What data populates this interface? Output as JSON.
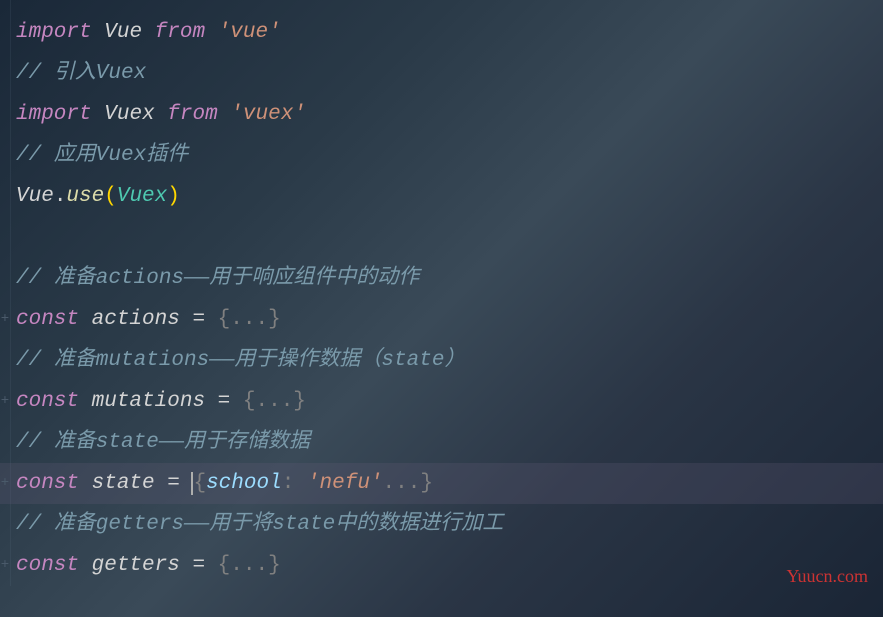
{
  "watermark": "Yuucn.com",
  "lines": {
    "l1": {
      "import": "import",
      "name": "Vue",
      "from": "from",
      "module": "'vue'"
    },
    "l2": {
      "comment": "// 引入Vuex"
    },
    "l3": {
      "import": "import",
      "name": "Vuex",
      "from": "from",
      "module": "'vuex'"
    },
    "l4": {
      "comment": "// 应用Vuex插件"
    },
    "l5": {
      "obj": "Vue",
      "dot": ".",
      "method": "use",
      "lparen": "(",
      "arg": "Vuex",
      "rparen": ")"
    },
    "l7": {
      "comment": "// 准备actions——用于响应组件中的动作"
    },
    "l8": {
      "const": "const",
      "name": "actions",
      "eq": "=",
      "lbrace": "{",
      "dots": "...",
      "rbrace": "}"
    },
    "l9": {
      "comment": "// 准备mutations——用于操作数据（state）"
    },
    "l10": {
      "const": "const",
      "name": "mutations",
      "eq": "=",
      "lbrace": "{",
      "dots": "...",
      "rbrace": "}"
    },
    "l11": {
      "comment": "// 准备state——用于存储数据"
    },
    "l12": {
      "const": "const",
      "name": "state",
      "eq": "=",
      "lbrace": "{",
      "key": "school",
      "colon": ":",
      "val": "'nefu'",
      "dots": "...",
      "rbrace": "}"
    },
    "l13": {
      "comment": "// 准备getters——用于将state中的数据进行加工"
    },
    "l14": {
      "const": "const",
      "name": "getters",
      "eq": "=",
      "lbrace": "{",
      "dots": "...",
      "rbrace": "}"
    }
  }
}
